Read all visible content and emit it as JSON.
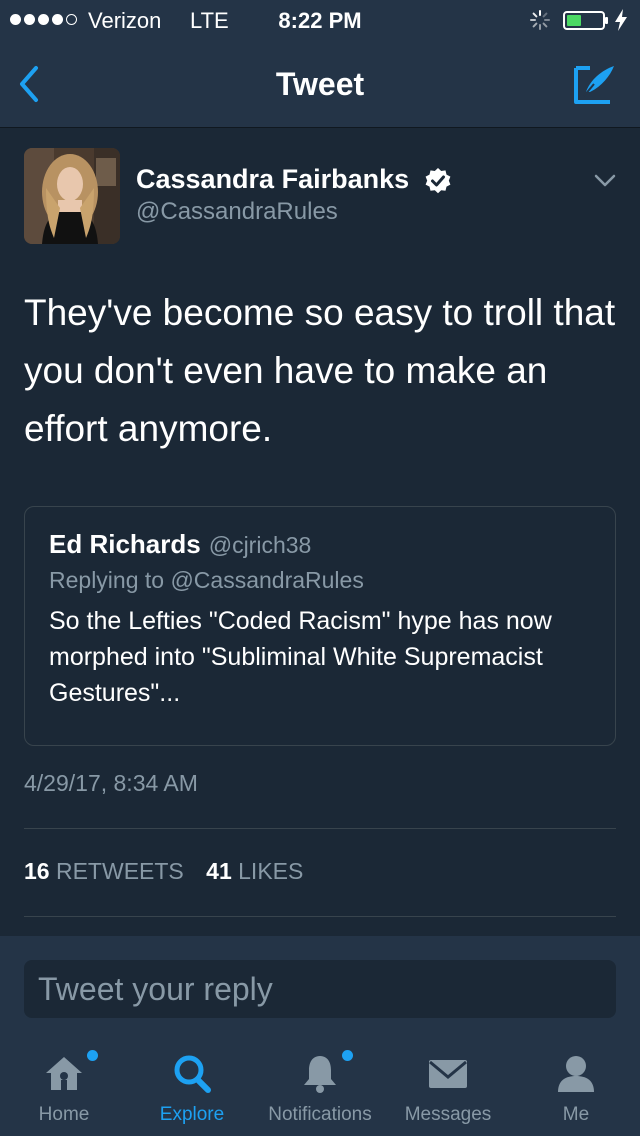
{
  "status_bar": {
    "carrier": "Verizon",
    "network": "LTE",
    "time": "8:22 PM"
  },
  "nav": {
    "title": "Tweet",
    "back_icon": "chevron-left-icon",
    "compose_icon": "compose-tweet-icon"
  },
  "tweet": {
    "author_name": "Cassandra Fairbanks",
    "author_handle": "@CassandraRules",
    "verified": true,
    "text": "They've become so easy to troll that you don't even have to make an effort anymore.",
    "quote": {
      "name": "Ed Richards",
      "handle": "@cjrich38",
      "replying_to": "Replying to @CassandraRules",
      "text": "So the Lefties \"Coded Racism\" hype has now morphed into \"Subliminal White Supremacist Gestures\"..."
    },
    "timestamp": "4/29/17, 8:34 AM",
    "retweets_count": "16",
    "retweets_label": "RETWEETS",
    "likes_count": "41",
    "likes_label": "LIKES"
  },
  "reply": {
    "placeholder": "Tweet your reply"
  },
  "tabs": [
    {
      "label": "Home",
      "icon": "home-icon",
      "active": false,
      "badge": true
    },
    {
      "label": "Explore",
      "icon": "search-icon",
      "active": true,
      "badge": false
    },
    {
      "label": "Notifications",
      "icon": "bell-icon",
      "active": false,
      "badge": true
    },
    {
      "label": "Messages",
      "icon": "envelope-icon",
      "active": false,
      "badge": false
    },
    {
      "label": "Me",
      "icon": "person-icon",
      "active": false,
      "badge": false
    }
  ],
  "colors": {
    "background": "#1b2836",
    "bar": "#243447",
    "accent": "#1da1f2",
    "secondary_text": "#8899a6",
    "battery": "#4cd964"
  }
}
